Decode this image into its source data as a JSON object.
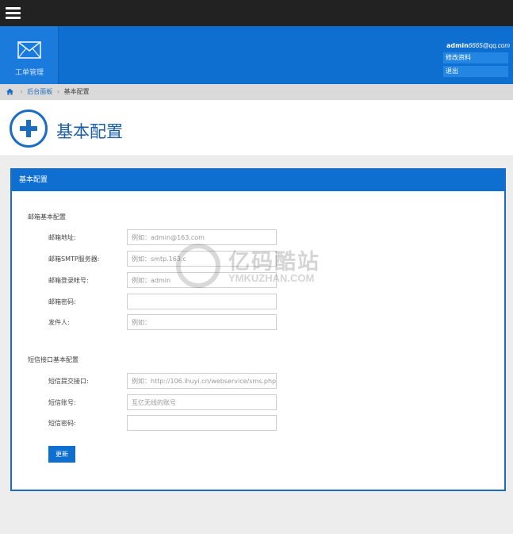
{
  "nav": {
    "menu_label": "",
    "tile_label": "工单管理"
  },
  "user": {
    "name": "admin",
    "email": "6665@qq.com",
    "menu": [
      "修改资料",
      "退出"
    ]
  },
  "breadcrumb": {
    "items": [
      "后台面板",
      "基本配置"
    ]
  },
  "page": {
    "title": "基本配置"
  },
  "panel": {
    "heading": "基本配置",
    "email_section": {
      "title": "邮箱基本配置",
      "fields": [
        {
          "label": "邮箱地址:",
          "value": "",
          "placeholder": "例如：admin@163.com"
        },
        {
          "label": "邮箱SMTP服务器:",
          "value": "",
          "placeholder": "例如：smtp.163.c"
        },
        {
          "label": "邮箱登录帐号:",
          "value": "",
          "placeholder": "例如：admin"
        },
        {
          "label": "邮箱密码:",
          "value": "",
          "placeholder": ""
        },
        {
          "label": "发件人:",
          "value": "",
          "placeholder": "例如："
        }
      ]
    },
    "sms_section": {
      "title": "短信接口基本配置",
      "fields": [
        {
          "label": "短信提交接口:",
          "value": "",
          "placeholder": "例如：http://106.ihuyi.cn/webservice/sms.php"
        },
        {
          "label": "短信账号:",
          "value": "",
          "placeholder": "互亿无线的账号"
        },
        {
          "label": "短信密码:",
          "value": "",
          "placeholder": ""
        }
      ]
    },
    "submit_label": "更新"
  },
  "watermark": {
    "text": "亿码酷站",
    "sub": "YMKUZHAN.COM"
  },
  "colors": {
    "primary": "#0e6fd1",
    "topbar": "#222222",
    "breadcrumb_bg": "#dadada"
  }
}
